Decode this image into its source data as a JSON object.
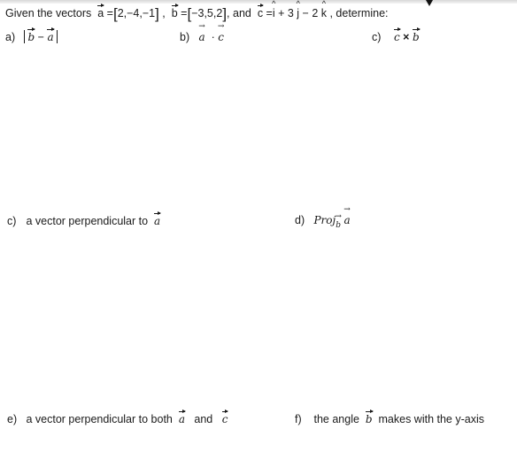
{
  "intro": {
    "prefix": "Given the vectors",
    "a_name": "a",
    "a_value": "2,−4,−1",
    "b_name": "b",
    "b_value": "−3,5,2",
    "and": ", and",
    "c_name": "c",
    "c_expr_i": "i",
    "c_plus": " + 3 ",
    "c_j": "j",
    "c_minus": " − 2 ",
    "c_k": "k",
    "suffix": ", determine:"
  },
  "parts": {
    "a": {
      "label": "a)",
      "v1": "b",
      "op": "−",
      "v2": "a"
    },
    "b": {
      "label": "b)",
      "v1": "a",
      "op": "·",
      "v2": "c"
    },
    "c1": {
      "label": "c)",
      "v1": "c",
      "op": "×",
      "v2": "b"
    },
    "c2": {
      "label": "c)",
      "text": "a vector perpendicular to",
      "v": "a"
    },
    "d": {
      "label": "d)",
      "proj": "Proj",
      "sub": "b",
      "v": "a"
    },
    "e": {
      "label": "e)",
      "text": "a vector perpendicular to both",
      "v1": "a",
      "and": "and",
      "v2": "c"
    },
    "f": {
      "label": "f)",
      "text1": "the angle",
      "v": "b",
      "text2": "makes with the y-axis"
    }
  }
}
